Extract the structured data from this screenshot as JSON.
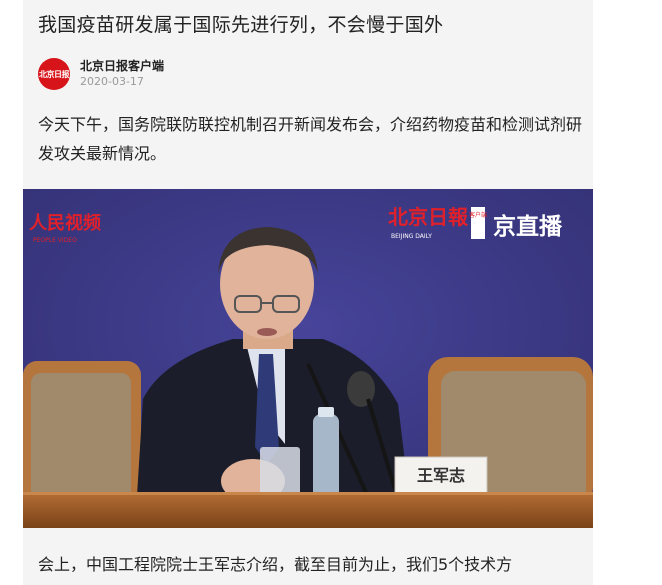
{
  "article": {
    "title": "我国疫苗研发属于国际先进行列，不会慢于国外",
    "author": "北京日报客户端",
    "avatar_text": "北京日报",
    "date": "2020-03-17",
    "paragraph1": "今天下午，国务院联防联控机制召开新闻发布会，介绍药物疫苗和检测试剂研发攻关最新情况。",
    "paragraph2": "会上，中国工程院院士王军志介绍，截至目前为止，我们5个技术方"
  },
  "photo": {
    "watermark_left": "人民视频",
    "watermark_left_sub": "PEOPLE VIDEO",
    "logo_main": "北京日報",
    "logo_sub": "BEIJING DAILY",
    "logo_client": "客户端",
    "logo_live": "京直播",
    "nameplate": "王军志"
  },
  "colors": {
    "brand_red": "#d7141a",
    "backdrop": "#3f3c8a"
  }
}
